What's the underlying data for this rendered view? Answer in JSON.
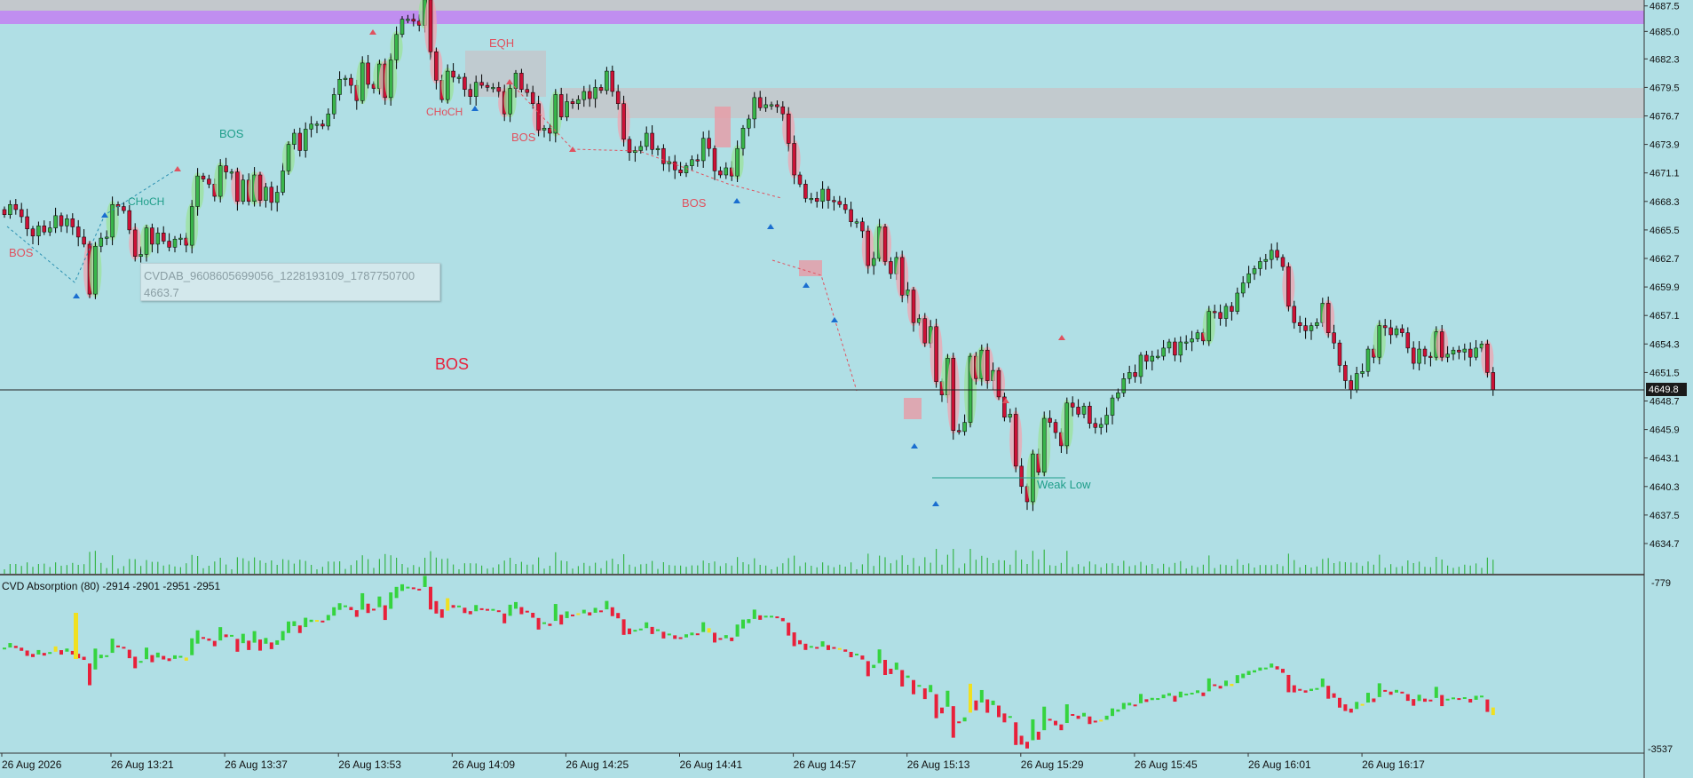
{
  "colors": {
    "background": "#b0dfe5",
    "bull_body": "#39b54a",
    "bear_body": "#cc1236",
    "wick": "#000000",
    "supply_zone": "#c3c8cc",
    "top_band": "#c08ef0",
    "structure_bullish": "#1f9e8a",
    "structure_bearish": "#e0525f",
    "volume": "#39b54a",
    "cvd_up": "#35d43f",
    "cvd_down": "#e8203a",
    "cvd_absorption": "#f0e020"
  },
  "price_axis": {
    "labels": [
      "4687.5",
      "4685.0",
      "4682.3",
      "4679.5",
      "4676.7",
      "4673.9",
      "4671.1",
      "4668.3",
      "4665.5",
      "4662.7",
      "4659.9",
      "4657.1",
      "4654.3",
      "4651.5",
      "4648.7",
      "4645.9",
      "4643.1",
      "4640.3",
      "4637.5",
      "4634.7"
    ],
    "current_price": "4649.8"
  },
  "time_axis": {
    "labels": [
      "26 Aug 2026",
      "26 Aug 13:21",
      "26 Aug 13:37",
      "26 Aug 13:53",
      "26 Aug 14:09",
      "26 Aug 14:25",
      "26 Aug 14:41",
      "26 Aug 14:57",
      "26 Aug 15:13",
      "26 Aug 15:29",
      "26 Aug 15:45",
      "26 Aug 16:01",
      "26 Aug 16:17"
    ]
  },
  "annotations": {
    "bos_left": "BOS",
    "choch_1": "CHoCH",
    "bos_2": "BOS",
    "eqh": "EQH",
    "choch_2": "CHoCH",
    "bos_3": "BOS",
    "bos_4": "BOS",
    "bos_big": "BOS",
    "weak_low": "Weak Low"
  },
  "tooltip": {
    "line1": "CVDAB_9608605699056_1228193109_1787750700",
    "line2": "4663.7"
  },
  "indicator": {
    "title": "CVD Absorption (80) -2914 -2901 -2951 -2951",
    "axis_top": "-779",
    "axis_bottom": "-3537"
  },
  "chart_data": {
    "type": "candlestick",
    "x_start": "26 Aug 2026 13:05",
    "ylim": [
      4633.0,
      4688.3
    ],
    "close": [
      4667.0,
      4668.0,
      4667.5,
      4666.8,
      4665.6,
      4664.9,
      4665.9,
      4665.3,
      4665.7,
      4666.9,
      4665.9,
      4666.6,
      4665.8,
      4664.8,
      4664.1,
      4659.2,
      4663.9,
      4664.7,
      4664.8,
      4668.0,
      4667.8,
      4667.4,
      4665.5,
      4662.9,
      4663.1,
      4665.7,
      4664.1,
      4665.2,
      4664.4,
      4663.8,
      4664.6,
      4664.7,
      4664.0,
      4667.8,
      4670.8,
      4670.5,
      4670.0,
      4668.8,
      4671.8,
      4671.2,
      4671.2,
      4668.3,
      4670.4,
      4668.3,
      4670.9,
      4668.4,
      4669.7,
      4668.2,
      4669.2,
      4671.3,
      4673.9,
      4675.0,
      4673.3,
      4675.4,
      4675.9,
      4675.9,
      4675.7,
      4676.9,
      4678.8,
      4680.3,
      4680.4,
      4679.7,
      4678.2,
      4681.9,
      4679.8,
      4679.4,
      4681.8,
      4678.5,
      4682.2,
      4684.7,
      4686.2,
      4686.2,
      4686.0,
      4685.6,
      4688.1,
      4683.0,
      4680.2,
      4678.3,
      4681.1,
      4680.5,
      4680.5,
      4679.3,
      4678.6,
      4680.0,
      4679.7,
      4679.5,
      4679.5,
      4679.1,
      4676.9,
      4679.4,
      4680.9,
      4679.3,
      4679.0,
      4677.9,
      4675.3,
      4675.5,
      4675.0,
      4678.8,
      4676.6,
      4678.1,
      4677.9,
      4678.3,
      4679.1,
      4678.4,
      4679.5,
      4679.2,
      4681.1,
      4679.1,
      4677.9,
      4674.4,
      4673.1,
      4673.3,
      4673.7,
      4675.0,
      4673.4,
      4673.5,
      4672.0,
      4672.2,
      4671.4,
      4671.1,
      4671.8,
      4672.4,
      4672.3,
      4674.5,
      4673.5,
      4671.3,
      4670.9,
      4671.6,
      4670.8,
      4673.5,
      4675.5,
      4676.4,
      4678.5,
      4677.5,
      4677.8,
      4677.8,
      4677.6,
      4676.9,
      4674.0,
      4670.9,
      4670.0,
      4668.6,
      4668.6,
      4668.3,
      4669.5,
      4668.4,
      4668.3,
      4668.0,
      4667.5,
      4666.3,
      4666.3,
      4665.4,
      4662.0,
      4662.7,
      4665.8,
      4662.4,
      4661.2,
      4662.8,
      4659.1,
      4659.6,
      4656.4,
      4656.8,
      4654.4,
      4656.0,
      4650.6,
      4649.3,
      4652.9,
      4645.8,
      4645.7,
      4646.6,
      4653.1,
      4650.9,
      4653.7,
      4650.7,
      4651.7,
      4649.1,
      4647.1,
      4647.4,
      4642.3,
      4640.3,
      4638.8,
      4643.5,
      4641.7,
      4647.0,
      4646.6,
      4645.6,
      4644.3,
      4648.5,
      4648.1,
      4647.4,
      4648.2,
      4646.5,
      4646.1,
      4646.4,
      4647.3,
      4649.0,
      4649.5,
      4650.9,
      4651.5,
      4651.1,
      4653.2,
      4652.6,
      4653.1,
      4653.1,
      4653.9,
      4654.5,
      4653.2,
      4654.5,
      4654.5,
      4654.8,
      4655.4,
      4654.6,
      4657.5,
      4657.4,
      4656.8,
      4658.0,
      4657.5,
      4659.3,
      4660.3,
      4661.2,
      4661.7,
      4662.4,
      4662.6,
      4663.5,
      4662.8,
      4661.9,
      4658.0,
      4656.4,
      4656.1,
      4655.6,
      4656.1,
      4656.4,
      4658.3,
      4655.4,
      4654.4,
      4652.2,
      4650.7,
      4649.8,
      4651.4,
      4651.6,
      4653.8,
      4653.0,
      4656.1,
      4655.9,
      4655.2,
      4655.8,
      4655.4,
      4653.9,
      4652.4,
      4653.8,
      4653.1,
      4653.0,
      4655.5,
      4653.0,
      4653.3,
      4653.7,
      4653.5,
      4653.8,
      4653.0,
      4653.9,
      4654.3,
      4651.5,
      4649.8
    ],
    "indicator_name": "CVD Absorption (80)",
    "indicator_values": [
      -2914,
      -2901,
      -2951,
      -2951
    ],
    "indicator_range": [
      -3537,
      -779
    ]
  }
}
